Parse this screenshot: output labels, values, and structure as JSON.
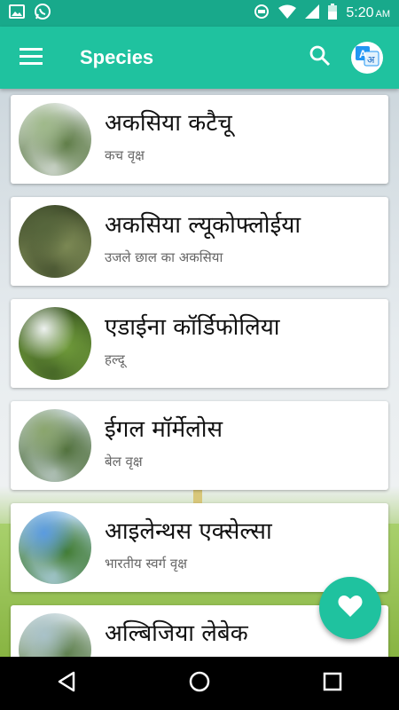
{
  "status_bar": {
    "time": "5:20",
    "ampm": "AM",
    "icons": [
      "image-icon",
      "whatsapp-icon",
      "data-saver-icon",
      "wifi-icon",
      "signal-icon",
      "battery-icon"
    ]
  },
  "app_bar": {
    "title": "Species",
    "menu_icon": "hamburger-menu-icon",
    "search_icon": "search-icon",
    "translate_icon": "translate-icon",
    "translate_letters": [
      "A",
      "अ"
    ]
  },
  "species": [
    {
      "name": "अकसिया कटैचू",
      "common_name": "कच वृक्ष",
      "thumb_colors": [
        "#9fb98a",
        "#5c7a44",
        "#e6eaea"
      ]
    },
    {
      "name": "अकसिया ल्यूकोफ्लोईया",
      "common_name": "उजले छाल का अकसिया",
      "thumb_colors": [
        "#56663c",
        "#7d8a55",
        "#3e4a2a"
      ]
    },
    {
      "name": "एडाईना कॉर्डिफोलिया",
      "common_name": "हल्दू",
      "thumb_colors": [
        "#eef2f0",
        "#6f9a3a",
        "#3c5a22"
      ]
    },
    {
      "name": "ईगल मॉर्मेलोस",
      "common_name": "बेल वृक्ष",
      "thumb_colors": [
        "#8aa56c",
        "#4f6f3a",
        "#c9d6d8"
      ]
    },
    {
      "name": "आइलेन्थस एक्सेल्सा",
      "common_name": "भारतीय स्वर्ग वृक्ष",
      "thumb_colors": [
        "#5a9be0",
        "#3f7a2e",
        "#b9d8f2"
      ]
    },
    {
      "name": "अल्बिजिया लेबेक",
      "common_name": "",
      "thumb_colors": [
        "#a9c2c9",
        "#5b7d49",
        "#d7e2e4"
      ]
    }
  ],
  "fab": {
    "icon": "heart-icon"
  },
  "nav_bar": {
    "icons": [
      "back-triangle-icon",
      "home-circle-icon",
      "recents-square-icon"
    ]
  },
  "colors": {
    "primary": "#1fc29f",
    "primary_dark": "#18a98b"
  }
}
